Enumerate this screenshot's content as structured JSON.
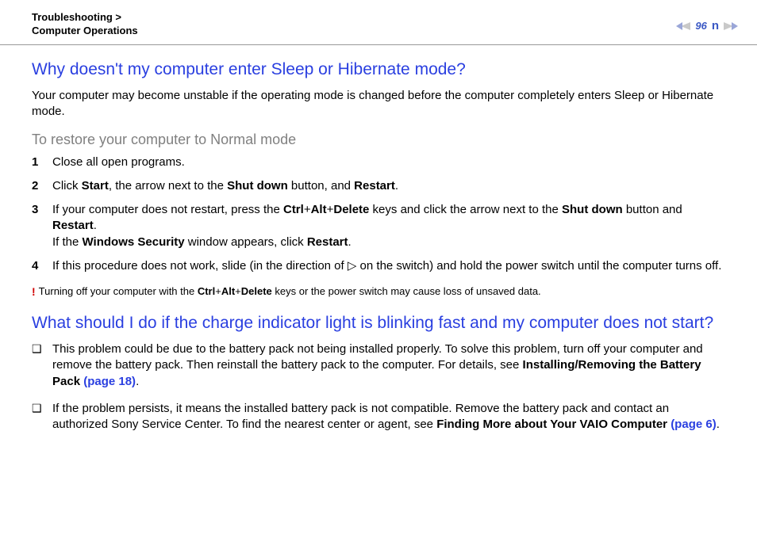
{
  "header": {
    "breadcrumb_line1": "Troubleshooting >",
    "breadcrumb_line2": "Computer Operations",
    "page_number": "96",
    "letter": "n"
  },
  "section1": {
    "title": "Why doesn't my computer enter Sleep or Hibernate mode?",
    "intro": "Your computer may become unstable if the operating mode is changed before the computer completely enters Sleep or Hibernate mode.",
    "subhead": "To restore your computer to Normal mode",
    "steps": [
      {
        "n": "1",
        "html": "Close all open programs."
      },
      {
        "n": "2",
        "html": "Click <b>Start</b>, the arrow next to the <b>Shut down</b> button, and <b>Restart</b>."
      },
      {
        "n": "3",
        "html": "If your computer does not restart, press the <b>Ctrl</b>+<b>Alt</b>+<b>Delete</b> keys and click the arrow next to the <b>Shut down</b> button and <b>Restart</b>.<br>If the <b>Windows Security</b> window appears, click <b>Restart</b>."
      },
      {
        "n": "4",
        "html": "If this procedure does not work, slide (in the direction of ▷ on the switch) and hold the power switch until the computer turns off."
      }
    ],
    "note_mark": "!",
    "note_html": "Turning off your computer with the <b>Ctrl</b>+<b>Alt</b>+<b>Delete</b> keys or the power switch may cause loss of unsaved data."
  },
  "section2": {
    "title": "What should I do if the charge indicator light is blinking fast and my computer does not start?",
    "bullets": [
      {
        "html": "This problem could be due to the battery pack not being installed properly. To solve this problem, turn off your computer and remove the battery pack. Then reinstall the battery pack to the computer. For details, see <b>Installing/Removing the Battery Pack <span class='link'>(page 18)</span></b>."
      },
      {
        "html": "If the problem persists, it means the installed battery pack is not compatible. Remove the battery pack and contact an authorized Sony Service Center. To find the nearest center or agent, see <b>Finding More about Your VAIO Computer <span class='link'>(page 6)</span></b>."
      }
    ]
  }
}
